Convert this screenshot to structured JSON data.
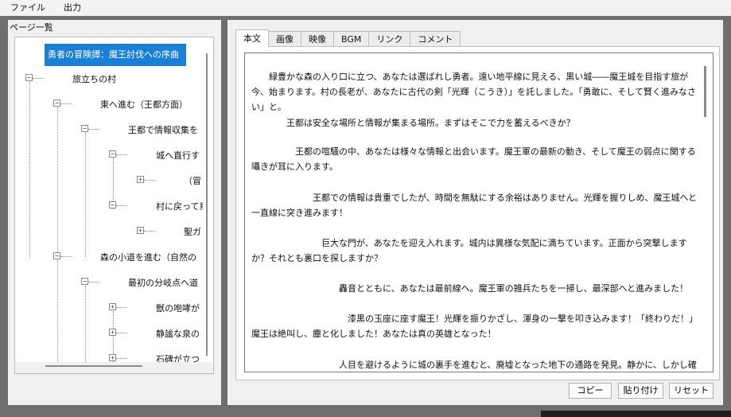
{
  "menubar": {
    "items": [
      "ファイル",
      "出力"
    ]
  },
  "left_panel": {
    "group_label": "ページ一覧",
    "tree": {
      "root": "勇者の冒険譚：魔王討伐への序曲",
      "nodes": [
        "旅立ちの村",
        "東へ進む（王都方面）",
        "王都で情報収集を",
        "城へ直行す",
        "（冒",
        "村に戻って鳥",
        "聖ガ",
        "森の小道を進む（自然の",
        "最初の分岐点へ道",
        "獣の咆哮が",
        "静謐な泉の",
        "石碑が立つ"
      ],
      "expander_minus": "−",
      "expander_plus": "+"
    }
  },
  "tabs": [
    "本文",
    "画像",
    "映像",
    "BGM",
    "リンク",
    "コメント"
  ],
  "body_text": [
    "　　緑豊かな森の入り口に立つ、あなたは選ばれし勇者。遠い地平線に見える、黒い城――魔王城を目指す旅が今、始まります。村の長老が、あなたに古代の剣「光輝（こうき）」を託しました。「勇敢に、そして賢く進みなさい」と。",
    "　　　　王都は安全な場所と情報が集まる場所。まずはそこで力を蓄えるべきか？",
    "　　　　　王都の喧騒の中、あなたは様々な情報と出会います。魔王軍の最新の動き、そして魔王の弱点に関する囁きが耳に入ります。",
    "　　　　　　　王都での情報は貴重でしたが、時間を無駄にする余裕はありません。光輝を握りしめ、魔王城へと一直線に突き進みます！",
    "　　　　　　　　巨大な門が、あなたを迎え入れます。城内は異様な気配に満ちています。正面から突撃しますか？それとも裏口を探しますか？",
    "　　　　　　　　　　轟音とともに、あなたは最前線へ。魔王軍の雑兵たちを一掃し、最深部へと進みました！",
    "　　　　　　　　　　　漆黒の玉座に座す魔王！光輝を振りかざし、渾身の一撃を叩き込みます！「終わりだ！」魔王は絶叫し、塵と化しました！あなたは真の英雄となった！",
    "　　　　　　　　　　人目を避けるように城の裏手を進むと、廃墟となった地下の通路を発見。静かに、しかし確実に敵陣に潜"
  ],
  "buttons": {
    "copy": "コピー",
    "paste": "貼り付け",
    "reset": "リセット"
  }
}
